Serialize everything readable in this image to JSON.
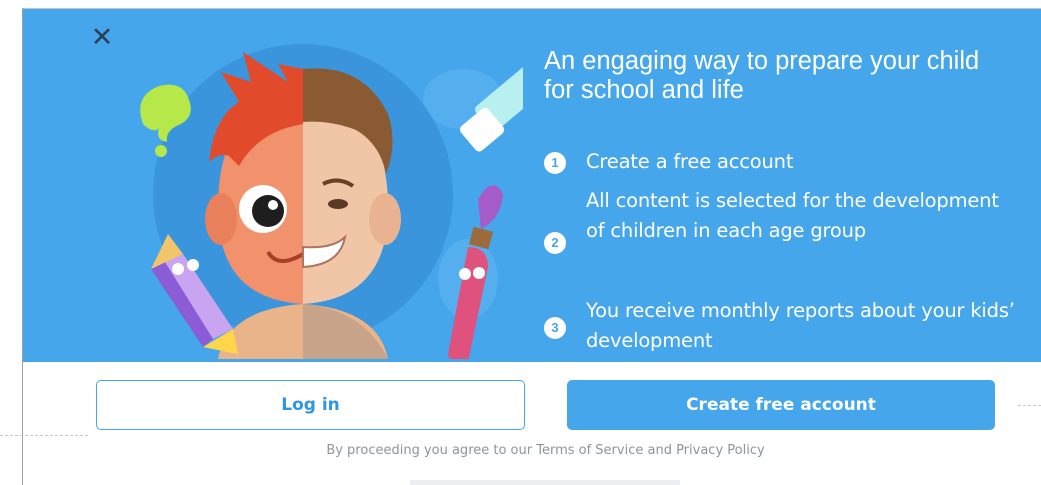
{
  "modal": {
    "close_icon": "close-icon",
    "headline": "An engaging way to prepare your child for school and life",
    "steps": [
      {
        "num": "1",
        "text": "Create a free account"
      },
      {
        "num": "2",
        "text": "All content is selected for the development of children in each age group"
      },
      {
        "num": "3",
        "text": "You receive monthly reports about your kids’ development"
      }
    ],
    "login_label": "Log in",
    "create_label": "Create free account",
    "legal": "By proceeding you agree to our Terms of Service and Privacy Policy"
  },
  "colors": {
    "accent": "#46a6ec",
    "close": "#2b4056",
    "legal_text": "#8e959c"
  },
  "illustration": {
    "description_icons": [
      "boy-face-illustration",
      "pencil-icon",
      "paint-brush-icon",
      "eraser-icon",
      "paint-splash-icon"
    ]
  }
}
